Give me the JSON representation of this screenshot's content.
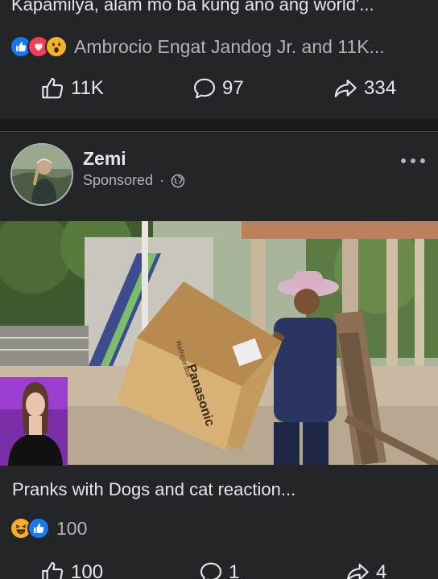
{
  "post1": {
    "caption": "Kapamilya, alam mo ba kung ano ang world'...",
    "reaction_icons": [
      "like-icon",
      "love-icon",
      "wow-icon"
    ],
    "reactors": "Ambrocio Engat Jandog Jr. and 11K...",
    "actions": {
      "likes": "11K",
      "comments": "97",
      "shares": "334"
    }
  },
  "post2": {
    "author": "Zemi",
    "meta": "Sponsored",
    "meta_separator": "·",
    "video": {
      "box_brand": "Panasonic",
      "box_label": "Refrigerator"
    },
    "caption": "Pranks with Dogs and cat reaction...",
    "reaction_icons": [
      "haha-icon",
      "like-icon"
    ],
    "reaction_count": "100",
    "actions": {
      "likes": "100",
      "comments": "1",
      "shares": "4"
    }
  },
  "colors": {
    "background": "#18191a",
    "card": "#242526",
    "text_primary": "#e4e6eb",
    "text_secondary": "#b0b3b8",
    "like_blue": "#1877f2",
    "love_red": "#f33e58",
    "emoji_yellow": "#f7b125"
  }
}
